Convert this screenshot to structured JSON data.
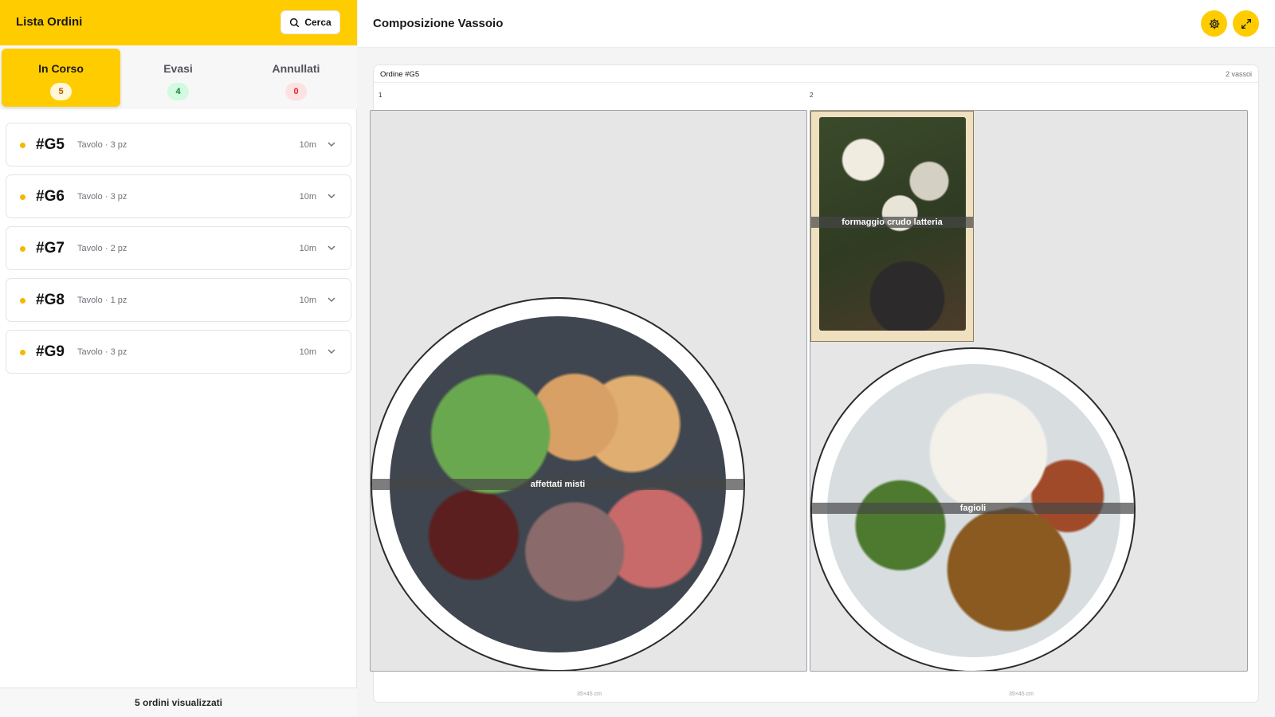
{
  "left": {
    "title": "Lista Ordini",
    "search_label": "Cerca",
    "tabs": [
      {
        "label": "In Corso",
        "count": "5"
      },
      {
        "label": "Evasi",
        "count": "4"
      },
      {
        "label": "Annullati",
        "count": "0"
      }
    ],
    "orders": [
      {
        "id": "#G5",
        "meta": "Tavolo · 3 pz",
        "time": "10m"
      },
      {
        "id": "#G6",
        "meta": "Tavolo · 3 pz",
        "time": "10m"
      },
      {
        "id": "#G7",
        "meta": "Tavolo · 2 pz",
        "time": "10m"
      },
      {
        "id": "#G8",
        "meta": "Tavolo · 1 pz",
        "time": "10m"
      },
      {
        "id": "#G9",
        "meta": "Tavolo · 3 pz",
        "time": "10m"
      }
    ],
    "footer": "5 ordini visualizzati"
  },
  "right": {
    "title": "Composizione Vassoio",
    "order_label": "Ordine #G5",
    "trays_count": "2 vassoi",
    "trays": [
      {
        "number": "1",
        "size": "35×45 cm",
        "items": [
          "affettati misti"
        ]
      },
      {
        "number": "2",
        "size": "35×45 cm",
        "items": [
          "formaggio crudo latteria",
          "fagioli"
        ]
      }
    ]
  },
  "colors": {
    "accent": "#ffcc00",
    "dot": "#f5b800"
  }
}
